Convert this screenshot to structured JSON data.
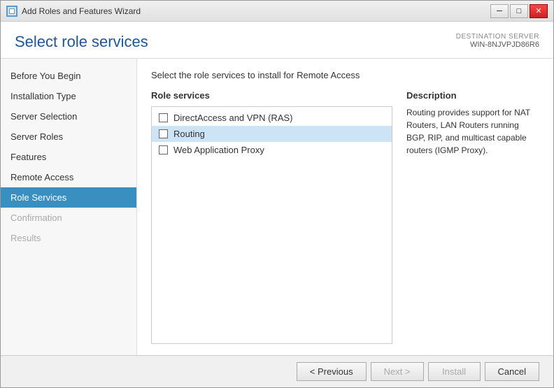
{
  "titleBar": {
    "title": "Add Roles and Features Wizard",
    "minimize": "─",
    "maximize": "□",
    "close": "✕"
  },
  "header": {
    "pageTitle": "Select role services",
    "destinationLabel": "DESTINATION SERVER",
    "serverName": "WIN-8NJVPJD86R6"
  },
  "sidebar": {
    "items": [
      {
        "label": "Before You Begin",
        "state": "normal"
      },
      {
        "label": "Installation Type",
        "state": "normal"
      },
      {
        "label": "Server Selection",
        "state": "normal"
      },
      {
        "label": "Server Roles",
        "state": "normal"
      },
      {
        "label": "Features",
        "state": "normal"
      },
      {
        "label": "Remote Access",
        "state": "normal"
      },
      {
        "label": "Role Services",
        "state": "active"
      },
      {
        "label": "Confirmation",
        "state": "disabled"
      },
      {
        "label": "Results",
        "state": "disabled"
      }
    ]
  },
  "content": {
    "instruction": "Select the role services to install for Remote Access",
    "roleServicesHeader": "Role services",
    "descriptionHeader": "Description",
    "services": [
      {
        "label": "DirectAccess and VPN (RAS)",
        "checked": false,
        "selected": false
      },
      {
        "label": "Routing",
        "checked": false,
        "selected": true
      },
      {
        "label": "Web Application Proxy",
        "checked": false,
        "selected": false
      }
    ],
    "description": "Routing provides support for NAT Routers, LAN Routers running BGP, RIP, and multicast capable routers (IGMP Proxy)."
  },
  "footer": {
    "previousLabel": "< Previous",
    "nextLabel": "Next >",
    "installLabel": "Install",
    "cancelLabel": "Cancel"
  }
}
